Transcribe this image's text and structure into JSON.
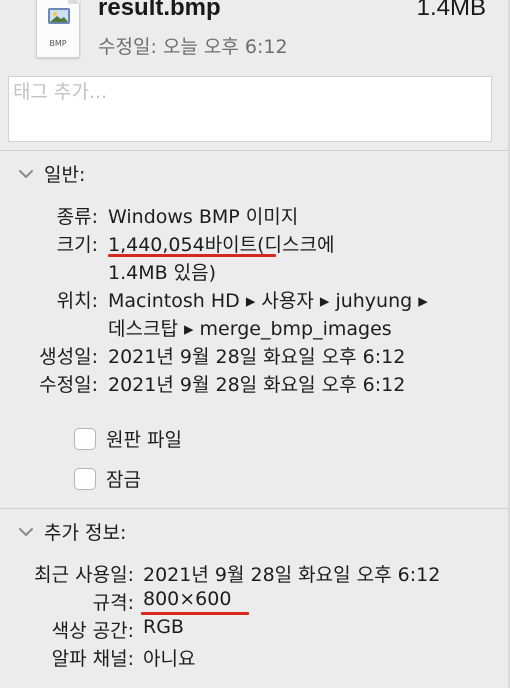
{
  "header": {
    "file_name": "result.bmp",
    "file_size": "1.4MB",
    "modified": "수정일: 오늘 오후 6:12",
    "icon": {
      "ext_label": "BMP",
      "name": "bmp-image-file-icon"
    }
  },
  "tags": {
    "placeholder": "태그 추가..."
  },
  "general": {
    "title": "일반:",
    "kind_label": "종류:",
    "kind_value": "Windows BMP 이미지",
    "size_label": "크기:",
    "size_value_line1": "1,440,054바이트(디스크에",
    "size_value_line2": "1.4MB 있음)",
    "where_label": "위치:",
    "where_line1": "Macintosh HD ▸ 사용자 ▸ juhyung ▸",
    "where_line2": "데스크탑 ▸ merge_bmp_images",
    "created_label": "생성일:",
    "created_value": "2021년 9월 28일 화요일 오후 6:12",
    "modified_label": "수정일:",
    "modified_value": "2021년 9월 28일 화요일 오후 6:12",
    "stationery_label": "원판 파일",
    "locked_label": "잠금",
    "stationery_checked": false,
    "locked_checked": false
  },
  "more_info": {
    "title": "추가 정보:",
    "last_opened_label": "최근 사용일:",
    "last_opened_value": "2021년 9월 28일 화요일 오후 6:12",
    "dimensions_label": "규격:",
    "dimensions_value": "800×600",
    "color_space_label": "색상 공간:",
    "color_space_value": "RGB",
    "alpha_label": "알파 채널:",
    "alpha_value": "아니요"
  },
  "colors": {
    "annotation_red": "#d7281e"
  }
}
